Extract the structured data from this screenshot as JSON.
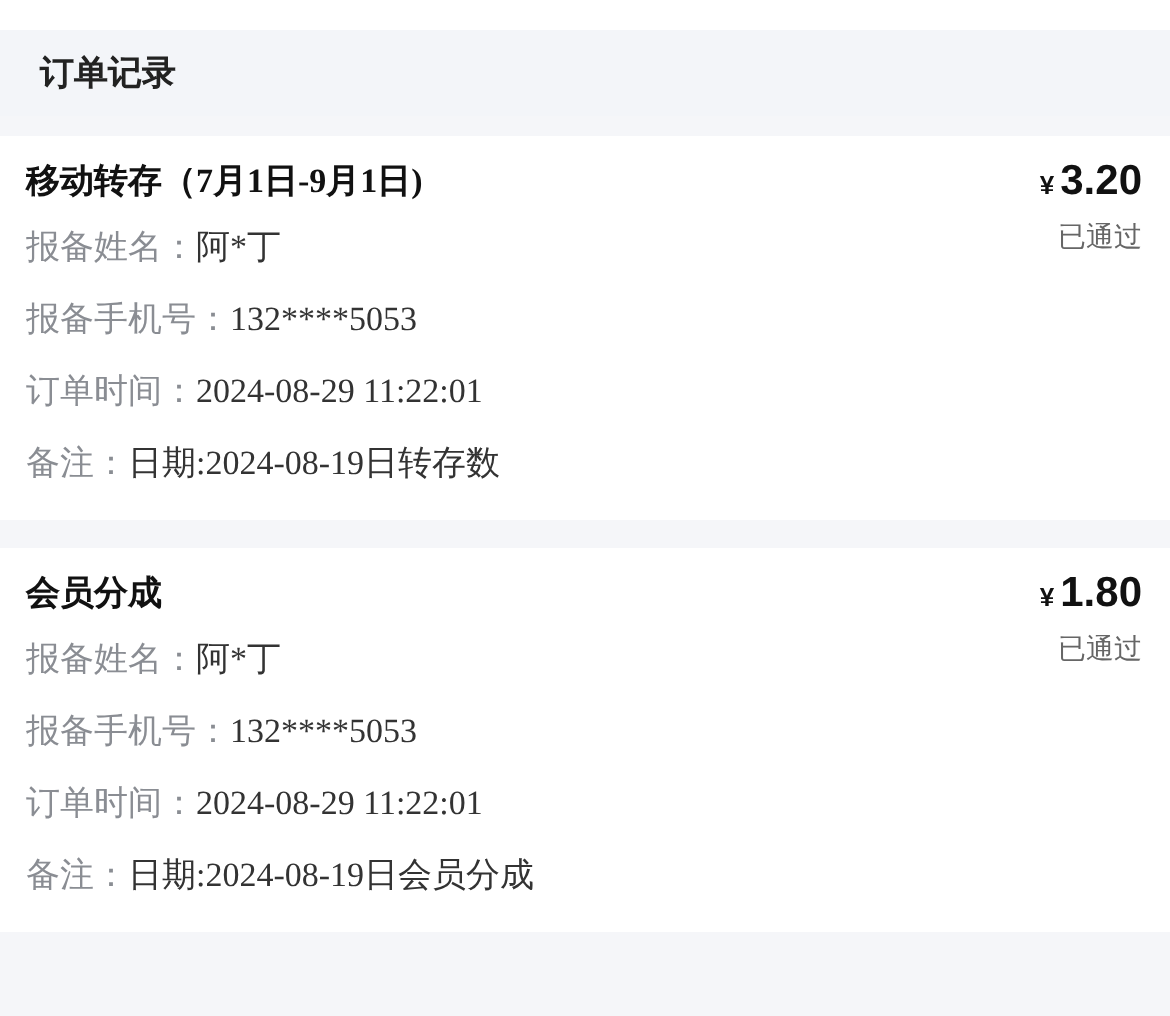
{
  "header": {
    "title": "订单记录"
  },
  "orders": [
    {
      "title": "移动转存（7月1日-9月1日)",
      "currency": "¥",
      "amount": "3.20",
      "status": "已通过",
      "fields": [
        {
          "label": "报备姓名：",
          "value": "阿*丁"
        },
        {
          "label": "报备手机号：",
          "value": "132****5053"
        },
        {
          "label": "订单时间：",
          "value": "2024-08-29 11:22:01"
        },
        {
          "label": "备注：",
          "value": "日期:2024-08-19日转存数"
        }
      ]
    },
    {
      "title": "会员分成",
      "currency": "¥",
      "amount": "1.80",
      "status": "已通过",
      "fields": [
        {
          "label": "报备姓名：",
          "value": "阿*丁"
        },
        {
          "label": "报备手机号：",
          "value": "132****5053"
        },
        {
          "label": "订单时间：",
          "value": "2024-08-29 11:22:01"
        },
        {
          "label": "备注：",
          "value": "日期:2024-08-19日会员分成"
        }
      ]
    }
  ]
}
